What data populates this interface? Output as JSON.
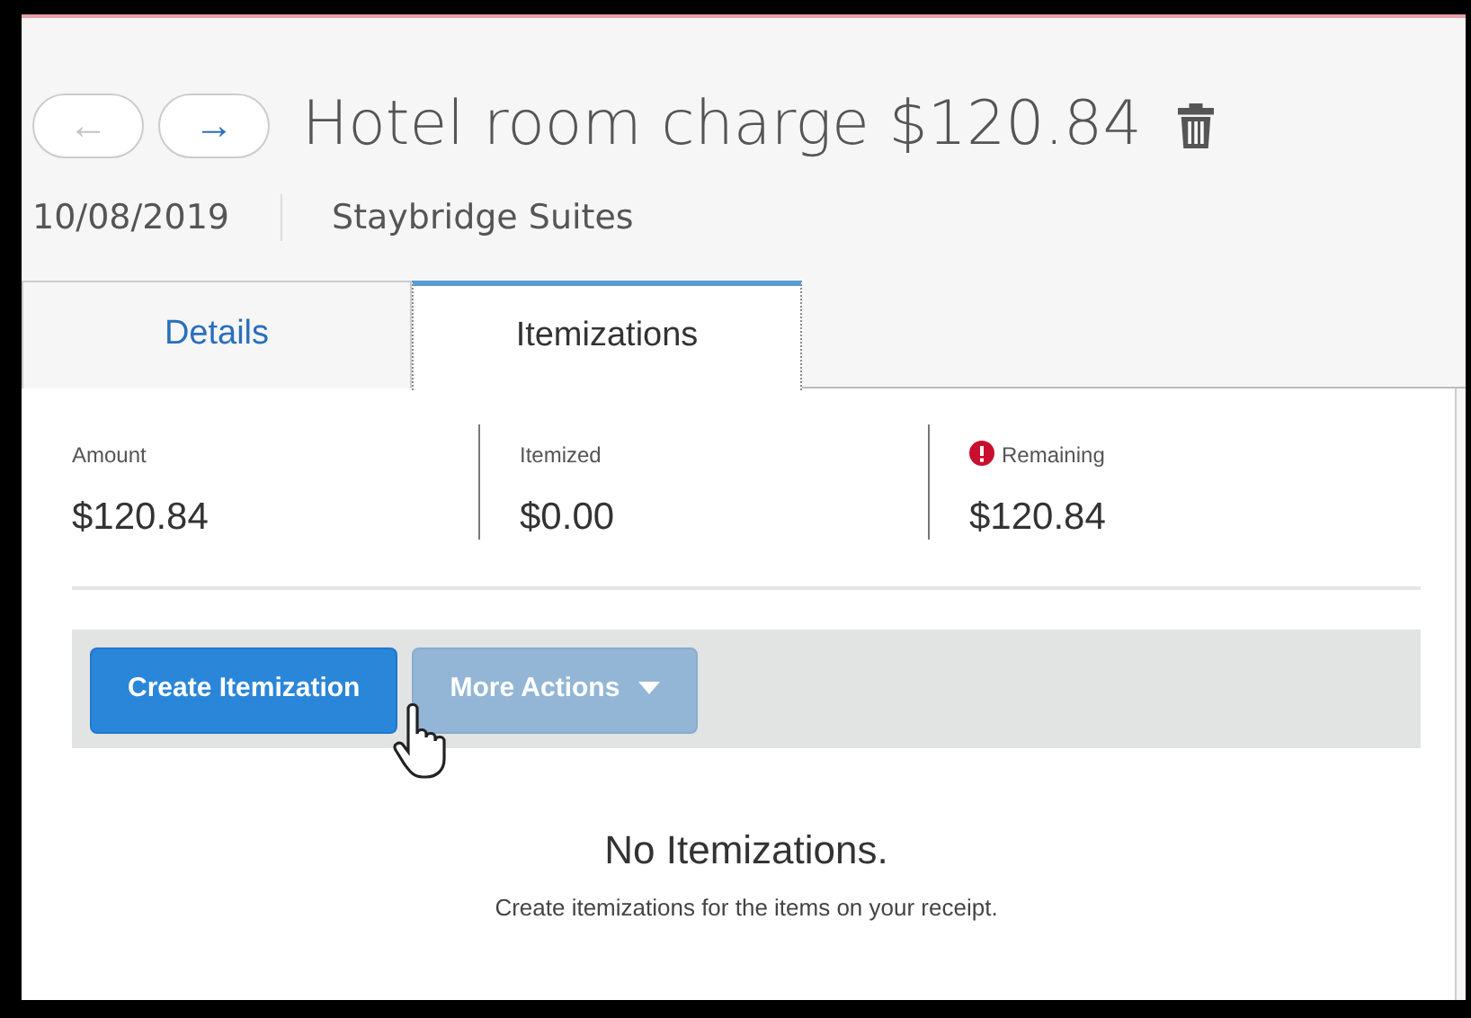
{
  "nav": [
    {
      "symbol": "←",
      "disabled": true
    },
    {
      "symbol": "→",
      "disabled": false
    }
  ],
  "title": "Hotel room charge $120.84",
  "meta": [
    "10/08/2019",
    "Staybridge Suites"
  ],
  "tabs": [
    {
      "label": "Details",
      "selected": false
    },
    {
      "label": "Itemizations",
      "selected": true
    }
  ],
  "summary": [
    {
      "label": "Amount",
      "value": "$120.84",
      "alert": false
    },
    {
      "label": "Itemized",
      "value": "$0.00",
      "alert": false
    },
    {
      "label": "Remaining",
      "value": "$120.84",
      "alert": true
    }
  ],
  "toolbar": [
    {
      "label": "Create Itemization",
      "disabled": false,
      "dropdown": false
    },
    {
      "label": "More Actions",
      "disabled": true,
      "dropdown": true
    }
  ],
  "empty": {
    "title": "No Itemizations.",
    "message": "Create itemizations for the items on your receipt."
  }
}
